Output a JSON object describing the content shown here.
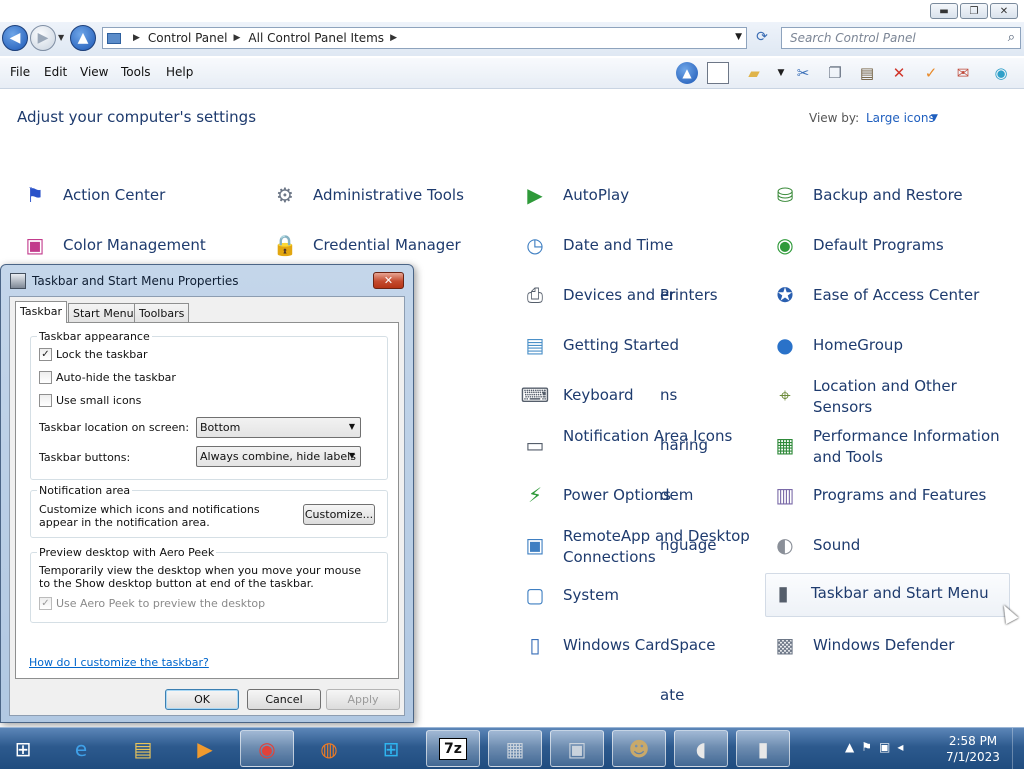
{
  "window": {
    "caption": {
      "minimize": "▬",
      "maximize": "❐",
      "close": "✕"
    }
  },
  "address": {
    "crumbs": [
      "Control Panel",
      "All Control Panel Items"
    ],
    "search_placeholder": "Search Control Panel"
  },
  "menu": [
    "File",
    "Edit",
    "View",
    "Tools",
    "Help"
  ],
  "content": {
    "heading": "Adjust your computer's settings",
    "view_by_label": "View by:",
    "view_by_value": "Large icons",
    "items": [
      {
        "label": "Action Center",
        "icon": "flag-icon",
        "glyph": "⚑",
        "color": "#2a52c9"
      },
      {
        "label": "Administrative Tools",
        "icon": "admin-tools-icon",
        "glyph": "⚙",
        "color": "#6d7787"
      },
      {
        "label": "AutoPlay",
        "icon": "autoplay-icon",
        "glyph": "▶",
        "color": "#2f9a3a"
      },
      {
        "label": "Backup and Restore",
        "icon": "backup-icon",
        "glyph": "⛁",
        "color": "#3a8a3a"
      },
      {
        "label": "Color Management",
        "icon": "color-management-icon",
        "glyph": "▣",
        "color": "#c23b8c"
      },
      {
        "label": "Credential Manager",
        "icon": "credential-icon",
        "glyph": "🔒",
        "color": "#b58b1c"
      },
      {
        "label": "Date and Time",
        "icon": "date-time-icon",
        "glyph": "◷",
        "color": "#3f7fc2"
      },
      {
        "label": "Default Programs",
        "icon": "default-programs-icon",
        "glyph": "◉",
        "color": "#2f9a3a"
      },
      {
        "label": "er",
        "icon": "partial-icon",
        "glyph": "",
        "color": "#ffffff"
      },
      {
        "label": "Devices and Printers",
        "icon": "printer-icon",
        "glyph": "⎙",
        "color": "#555e6b"
      },
      {
        "label": "Ease of Access Center",
        "icon": "ease-of-access-icon",
        "glyph": "✪",
        "color": "#2a5fb0"
      },
      {
        "label": "Getting Started",
        "icon": "getting-started-icon",
        "glyph": "▤",
        "color": "#4b90c8"
      },
      {
        "label": "HomeGroup",
        "icon": "homegroup-icon",
        "glyph": "●",
        "color": "#2a72c9"
      },
      {
        "label": "ns",
        "icon": "partial-icon",
        "glyph": "",
        "color": "#ffffff"
      },
      {
        "label": "Keyboard",
        "icon": "keyboard-icon",
        "glyph": "⌨",
        "color": "#555e6b"
      },
      {
        "label": "Location and Other Sensors",
        "icon": "location-icon",
        "glyph": "⌖",
        "color": "#6d8a3a"
      },
      {
        "label": "haring",
        "icon": "partial-icon",
        "glyph": "",
        "color": "#ffffff"
      },
      {
        "label": "Notification Area Icons",
        "icon": "notification-icon",
        "glyph": "▭",
        "color": "#555e6b"
      },
      {
        "label": "Performance Information and Tools",
        "icon": "performance-icon",
        "glyph": "▦",
        "color": "#2f8a3a"
      },
      {
        "label": "dem",
        "icon": "partial-icon",
        "glyph": "",
        "color": "#ffffff"
      },
      {
        "label": "Power Options",
        "icon": "power-icon",
        "glyph": "⚡",
        "color": "#2f9a3a"
      },
      {
        "label": "Programs and Features",
        "icon": "programs-icon",
        "glyph": "▥",
        "color": "#7a6aa8"
      },
      {
        "label": "nguage",
        "icon": "partial-icon",
        "glyph": "",
        "color": "#ffffff"
      },
      {
        "label": "RemoteApp and Desktop Connections",
        "icon": "remoteapp-icon",
        "glyph": "▣",
        "color": "#3f7fc2"
      },
      {
        "label": "Sound",
        "icon": "sound-icon",
        "glyph": "◐",
        "color": "#8a8f98"
      },
      {
        "label": "System",
        "icon": "system-icon",
        "glyph": "▢",
        "color": "#3f7fc2"
      },
      {
        "label": "Taskbar and Start Menu",
        "icon": "taskbar-icon",
        "glyph": "▮",
        "color": "#555e6b"
      },
      {
        "label": "Windows CardSpace",
        "icon": "cardspace-icon",
        "glyph": "▯",
        "color": "#3a6fb8"
      },
      {
        "label": "Windows Defender",
        "icon": "defender-icon",
        "glyph": "▩",
        "color": "#6d7787"
      },
      {
        "label": "ate",
        "icon": "partial-icon",
        "glyph": "",
        "color": "#ffffff"
      }
    ]
  },
  "dialog": {
    "title": "Taskbar and Start Menu Properties",
    "close": "✕",
    "tabs": [
      "Taskbar",
      "Start Menu",
      "Toolbars"
    ],
    "appearance": {
      "title": "Taskbar appearance",
      "lock": {
        "label": "Lock the taskbar",
        "checked": "✓"
      },
      "autohide": {
        "label": "Auto-hide the taskbar",
        "checked": ""
      },
      "small_icons": {
        "label": "Use small icons",
        "checked": ""
      },
      "location_label": "Taskbar location on screen:",
      "location_value": "Bottom",
      "buttons_label": "Taskbar buttons:",
      "buttons_value": "Always combine, hide labels"
    },
    "notification": {
      "title": "Notification area",
      "desc": "Customize which icons and notifications appear in the notification area.",
      "button": "Customize..."
    },
    "aero": {
      "title": "Preview desktop with Aero Peek",
      "desc": "Temporarily view the desktop when you move your mouse to the Show desktop button at end of the taskbar.",
      "checkbox_label": "Use Aero Peek to preview the desktop",
      "checked": "✓"
    },
    "help_link": "How do I customize the taskbar?",
    "ok": "OK",
    "cancel": "Cancel",
    "apply": "Apply"
  },
  "taskbar": {
    "start_glyph": "⊞",
    "apps": [
      {
        "name": "internet-explorer-icon",
        "glyph": "e",
        "color": "#3fa0e8"
      },
      {
        "name": "file-explorer-icon",
        "glyph": "▤",
        "color": "#e8c45a"
      },
      {
        "name": "media-player-icon",
        "glyph": "▶",
        "color": "#f09a2e"
      },
      {
        "name": "chrome-icon",
        "glyph": "◉",
        "color": "#e0423a"
      },
      {
        "name": "firefox-icon",
        "glyph": "◍",
        "color": "#f07b23"
      },
      {
        "name": "windows-tile-icon",
        "glyph": "⊞",
        "color": "#2fb5f0"
      },
      {
        "name": "7zip-icon",
        "glyph": "7z",
        "color": "#111111"
      },
      {
        "name": "calculator-icon",
        "glyph": "▦",
        "color": "#c9d2dc"
      },
      {
        "name": "control-panel-icon",
        "glyph": "▣",
        "color": "#c9d2dc"
      },
      {
        "name": "users-icon",
        "glyph": "☻",
        "color": "#c9a96a"
      },
      {
        "name": "mouse-icon",
        "glyph": "◖",
        "color": "#e8e8e8"
      },
      {
        "name": "taskbar-properties-icon",
        "glyph": "▮",
        "color": "#e8e8e8"
      }
    ],
    "time": "2:58 PM",
    "date": "7/1/2023"
  }
}
